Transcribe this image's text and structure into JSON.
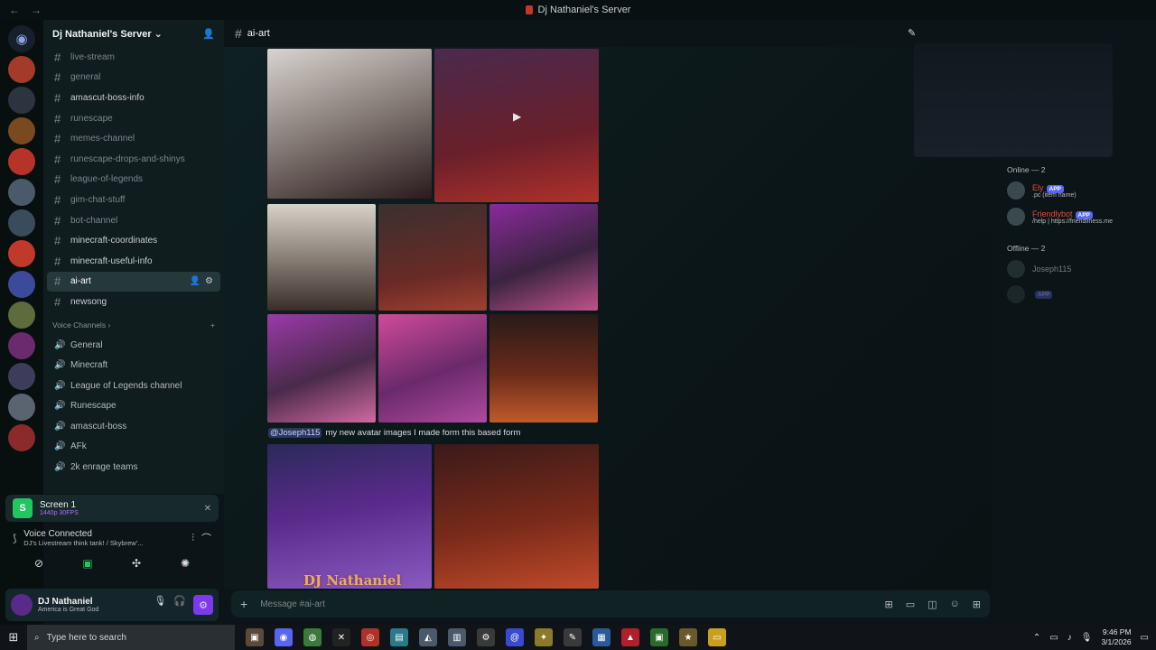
{
  "window": {
    "title": "Dj Nathaniel's Server",
    "back": "←",
    "forward": "→"
  },
  "server": {
    "name": "Dj Nathaniel's Server",
    "chevron": "⌄",
    "invite_icon": "add-member-icon"
  },
  "channels": [
    {
      "name": "live-stream",
      "style": "dim"
    },
    {
      "name": "general",
      "style": "dim"
    },
    {
      "name": "amascut-boss-info",
      "style": "bright"
    },
    {
      "name": "runescape",
      "style": "dim"
    },
    {
      "name": "memes-channel",
      "style": "dim"
    },
    {
      "name": "runescape-drops-and-shinys",
      "style": "dim"
    },
    {
      "name": "league-of-legends",
      "style": "dim"
    },
    {
      "name": "gim-chat-stuff",
      "style": "dim"
    },
    {
      "name": "bot-channel",
      "style": "dim"
    },
    {
      "name": "minecraft-coordinates",
      "style": "bright"
    },
    {
      "name": "minecraft-useful-info",
      "style": "bright"
    },
    {
      "name": "ai-art",
      "style": "active"
    },
    {
      "name": "newsong",
      "style": "bright"
    }
  ],
  "voice_section": {
    "label": "Voice Channels",
    "add": "+"
  },
  "voice_channels": [
    "General",
    "Minecraft",
    "League of Legends channel",
    "Runescape",
    "amascut-boss",
    "AFk",
    "2k enrage teams"
  ],
  "stream": {
    "title": "Screen 1",
    "quality": "1440p 30FPS"
  },
  "voice": {
    "status": "Voice Connected",
    "detail": "DJ's Livestream think tank! / Skybrew'..."
  },
  "user": {
    "name": "DJ Nathaniel",
    "status": "America is Great God"
  },
  "chat": {
    "channel": "ai-art",
    "mention": "@Joseph115",
    "message": "my new avatar images I made form this based form",
    "image_text": "DJ Nathaniel",
    "placeholder": "Message #ai-art"
  },
  "members": {
    "online_header": "Online — 2",
    "offline_header": "Offline — 2",
    "online": [
      {
        "name": "Ely",
        "badge": "APP",
        "sub": ".pc (item name)",
        "color": "#e74c3c"
      },
      {
        "name": "Friendlybot",
        "badge": "APP",
        "sub": "/help | https://friendliness.me",
        "color": "#e74c3c"
      }
    ],
    "offline": [
      {
        "name": "Joseph115",
        "badge": ""
      },
      {
        "name": "",
        "badge": "APP"
      }
    ]
  },
  "taskbar": {
    "search_placeholder": "Type here to search",
    "time": "9:46 PM",
    "date": "3/1/2026"
  }
}
